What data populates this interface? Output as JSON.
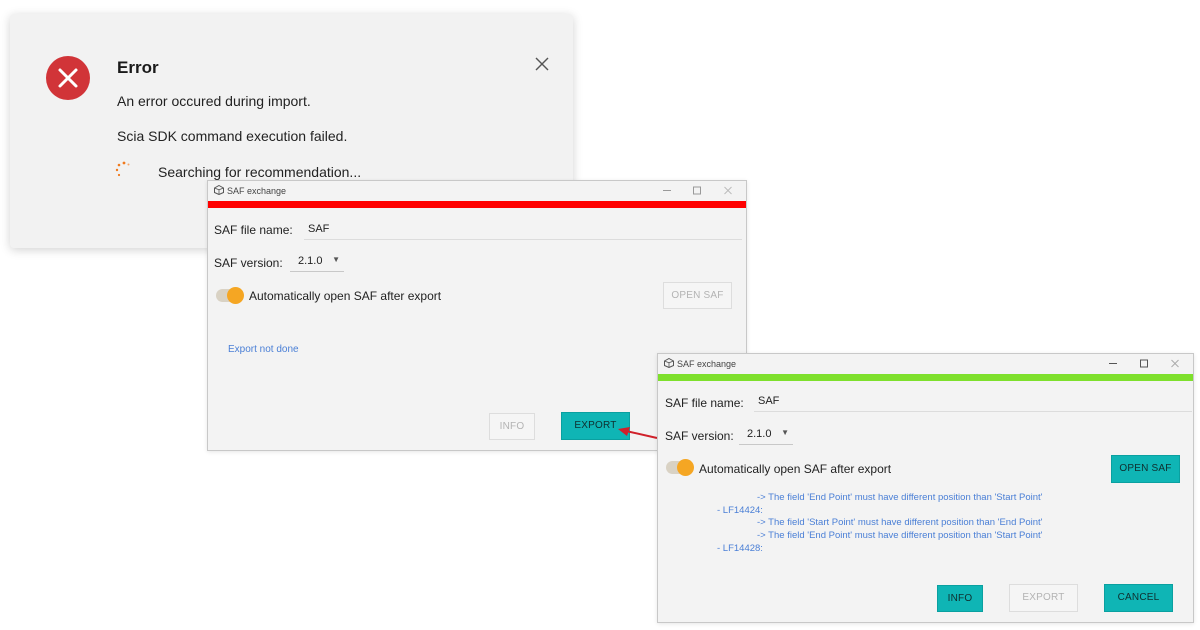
{
  "error_dialog": {
    "title": "Error",
    "message_1": "An error occured during import.",
    "message_2": "Scia SDK command execution failed.",
    "searching": "Searching for recommendation...",
    "icon": "error-x-icon",
    "accent_color": "#d13438",
    "spinner_color": "#f07a1e"
  },
  "window_1": {
    "title": "SAF exchange",
    "status_color": "#ff0000",
    "file_name_label": "SAF file name:",
    "file_name_value": "SAF",
    "version_label": "SAF version:",
    "version_value": "2.1.0",
    "auto_open_label": "Automatically open SAF after export",
    "auto_open_enabled": true,
    "open_saf_label": "OPEN SAF",
    "status_text": "Export not done",
    "info_label": "INFO",
    "export_label": "EXPORT"
  },
  "window_2": {
    "title": "SAF exchange",
    "status_color": "#7ee02c",
    "file_name_label": "SAF file name:",
    "file_name_value": "SAF",
    "version_label": "SAF version:",
    "version_value": "2.1.0",
    "auto_open_label": "Automatically open SAF after export",
    "auto_open_enabled": true,
    "open_saf_label": "OPEN SAF",
    "log": [
      "-> The field 'End Point' must have different position than 'Start Point'",
      "- LF14424:",
      "-> The field 'Start Point' must have different position than 'End Point'",
      "-> The field 'End Point' must have different position than 'Start Point'",
      "- LF14428:"
    ],
    "info_label": "INFO",
    "export_label": "EXPORT",
    "cancel_label": "CANCEL"
  },
  "accent_teal": "#0fb5b5",
  "arrow_color": "#d0202a"
}
